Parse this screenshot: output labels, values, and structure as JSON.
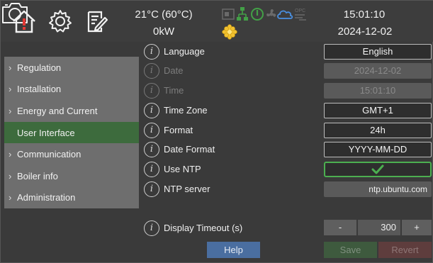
{
  "header": {
    "temperature": "21°C (60°C)",
    "power": "0kW",
    "time": "15:01:10",
    "date": "2024-12-02",
    "status_opc_label": "OPC",
    "icons": [
      "home-alert-icon",
      "gear-icon",
      "notes-icon",
      "camera-icon",
      "network-icon",
      "power-icon",
      "fan-icon",
      "cloud-icon",
      "opc-icon",
      "flower-icon"
    ],
    "colors": {
      "alert_red": "#e53935",
      "status_green": "#43a047",
      "cloud_blue": "#4a90e2",
      "flower_yellow": "#f2c230"
    }
  },
  "sidebar": {
    "items": [
      {
        "label": "Regulation",
        "active": false
      },
      {
        "label": "Installation",
        "active": false
      },
      {
        "label": "Energy and Current",
        "active": false
      },
      {
        "label": "User Interface",
        "active": true
      },
      {
        "label": "Communication",
        "active": false
      },
      {
        "label": "Boiler info",
        "active": false
      },
      {
        "label": "Administration",
        "active": false
      }
    ],
    "chevron": "›"
  },
  "settings": {
    "info_glyph": "i",
    "language": {
      "label": "Language",
      "value": "English"
    },
    "date": {
      "label": "Date",
      "value": "2024-12-02"
    },
    "time": {
      "label": "Time",
      "value": "15:01:10"
    },
    "time_zone": {
      "label": "Time Zone",
      "value": "GMT+1"
    },
    "format": {
      "label": "Format",
      "value": "24h"
    },
    "date_format": {
      "label": "Date Format",
      "value": "YYYY-MM-DD"
    },
    "use_ntp": {
      "label": "Use NTP",
      "checked": true
    },
    "ntp_server": {
      "label": "NTP server",
      "value": "ntp.ubuntu.com"
    },
    "display_timeout": {
      "label": "Display Timeout (s)",
      "value": "300",
      "minus": "-",
      "plus": "+"
    }
  },
  "buttons": {
    "help": "Help",
    "save": "Save",
    "revert": "Revert"
  },
  "colors": {
    "background": "#3a3a3a",
    "sidebar": "#6e6e6e",
    "active_item": "#3d6b3d",
    "check_green": "#4caf50"
  }
}
